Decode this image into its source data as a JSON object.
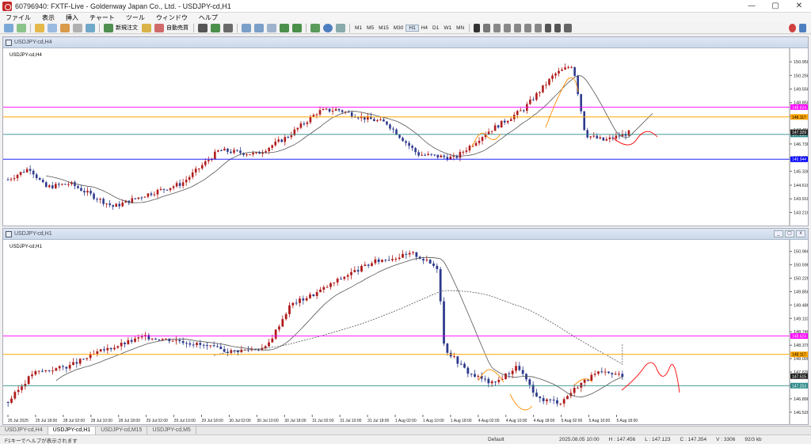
{
  "window": {
    "title": "60796940: FXTF-Live - Goldenway Japan Co., Ltd. - USDJPY-cd,H1",
    "minimize": "—",
    "maximize": "▢",
    "close": "✕"
  },
  "menu": [
    "ファイル",
    "表示",
    "挿入",
    "チャート",
    "ツール",
    "ウィンドウ",
    "ヘルプ"
  ],
  "toolbar": {
    "new_order": "新規注文",
    "auto_trade": "自動売買",
    "timeframes": [
      "M1",
      "M5",
      "M15",
      "M30",
      "H1",
      "H4",
      "D1",
      "W1",
      "MN"
    ],
    "active_timeframe": "H1"
  },
  "colors": {
    "bull": "#b01a1a",
    "bear": "#2d3a8c",
    "magenta_line": "#ff00ff",
    "orange_line": "#ffa500",
    "teal_line": "#2e8b8b",
    "blue_line": "#0000ff",
    "forecast": "#ff0000",
    "pattern": "#ff8c00",
    "ma": "#555555"
  },
  "chart_top": {
    "window_label": "USDJPY-cd,H4",
    "symbol_label": "USDJPY-cd,H4",
    "ylim": [
      142.7,
      151.4
    ],
    "y_ticks": [
      "150.950",
      "150.250",
      "149.550",
      "148.850",
      "148.150",
      "147.450",
      "146.730",
      "146.030",
      "145.330",
      "144.610",
      "143.910",
      "143.210"
    ],
    "levels": [
      {
        "name": "magenta",
        "value": 148.624,
        "label": "148.624"
      },
      {
        "name": "orange",
        "value": 148.117,
        "label": "148.117"
      },
      {
        "name": "teal",
        "value": 147.219,
        "label": "147.219"
      },
      {
        "name": "current",
        "value": 147.329,
        "label": "147.329"
      },
      {
        "name": "blue",
        "value": 145.944,
        "label": "145.944"
      }
    ]
  },
  "chart_bottom": {
    "window_label": "USDJPY-cd,H1",
    "symbol_label": "USDJPY-cd,H1",
    "ylim": [
      146.45,
      151.15
    ],
    "y_ticks": [
      "150.960",
      "150.590",
      "150.220",
      "149.850",
      "149.480",
      "149.110",
      "148.740",
      "148.370",
      "148.000",
      "147.630",
      "147.260",
      "146.890",
      "146.520"
    ],
    "x_ticks": [
      "25 Jul 2025",
      "25 Jul 18:00",
      "28 Jul 02:00",
      "28 Jul 10:00",
      "28 Jul 18:00",
      "29 Jul 02:00",
      "29 Jul 10:00",
      "29 Jul 18:00",
      "30 Jul 02:00",
      "30 Jul 10:00",
      "30 Jul 18:00",
      "31 Jul 02:00",
      "31 Jul 10:00",
      "31 Jul 18:00",
      "1 Aug 02:00",
      "1 Aug 10:00",
      "1 Aug 18:00",
      "4 Aug 02:00",
      "4 Aug 10:00",
      "4 Aug 18:00",
      "5 Aug 02:00",
      "5 Aug 10:00",
      "5 Aug 18:00"
    ],
    "levels": [
      {
        "name": "magenta",
        "value": 148.624,
        "label": "148.624"
      },
      {
        "name": "orange",
        "value": 148.117,
        "label": "148.117"
      },
      {
        "name": "current",
        "value": 147.515,
        "label": "147.515"
      },
      {
        "name": "teal",
        "value": 147.253,
        "label": "147.253"
      }
    ]
  },
  "tabs": [
    "USDJPY-cd,H4",
    "USDJPY-cd,H1",
    "USDJPY-cd,M15",
    "USDJPY-cd,M5"
  ],
  "active_tab": "USDJPY-cd,H1",
  "status": {
    "left": "F1キーでヘルプが表示されます",
    "profile": "Default",
    "time": "2025.08.05 10:00",
    "high": "H : 147.456",
    "low": "L : 147.123",
    "close": "C : 147.354",
    "volume": "V : 3306",
    "traffic": "92/3 kb"
  }
}
